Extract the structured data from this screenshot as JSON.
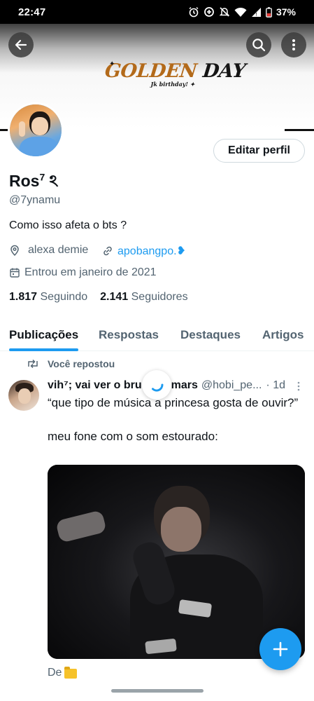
{
  "status_bar": {
    "time": "22:47",
    "battery": "37%",
    "icons": [
      "alarm-icon",
      "data-saver-icon",
      "mute-icon",
      "wifi-icon",
      "signal-icon",
      "battery-icon"
    ]
  },
  "header": {
    "back_icon": "arrow-left-icon",
    "search_icon": "search-icon",
    "more_icon": "more-vertical-icon",
    "banner_title_part1": "GOLDEN",
    "banner_title_part2": "DAY",
    "banner_subtitle": "Jk birthday!"
  },
  "profile": {
    "edit_button_label": "Editar perfil",
    "display_name": "Ros",
    "display_name_sup": "7",
    "display_name_suffix": "ঽ",
    "handle": "@7ynamu",
    "bio": "Como isso afeta o bts ?",
    "location": "alexa demie",
    "link": "apobangpo.❥",
    "joined": "Entrou em janeiro de 2021",
    "following_count": "1.817",
    "following_label": "Seguindo",
    "followers_count": "2.141",
    "followers_label": "Seguidores"
  },
  "tabs": [
    {
      "label": "Publicações",
      "active": true
    },
    {
      "label": "Respostas",
      "active": false
    },
    {
      "label": "Destaques",
      "active": false
    },
    {
      "label": "Artigos",
      "active": false
    }
  ],
  "post": {
    "repost_label": "Você repostou",
    "author": "vih⁷; vai ver o bru",
    "author_tail": "mars",
    "handle": "@hobi_pe...",
    "time": "· 1d",
    "text": "“que tipo de música a princesa gosta de ouvir?”\n\nmeu fone com o som estourado:",
    "footer_text": "De"
  },
  "colors": {
    "accent": "#1d9bf0",
    "text_primary": "#0f1419",
    "text_secondary": "#536471",
    "logo_gold": "#b36a1a"
  }
}
